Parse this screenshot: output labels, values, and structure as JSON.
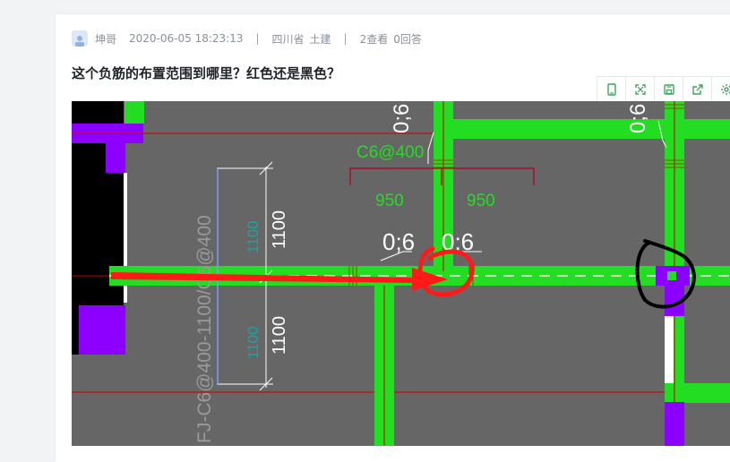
{
  "post": {
    "author": "坤哥",
    "datetime": "2020-06-05 18:23:13",
    "separator": "|",
    "province": "四川省",
    "category": "土建",
    "views": "2查看",
    "answers": "0回答",
    "title": "这个负筋的布置范围到哪里？红色还是黑色？"
  },
  "toolbar": {
    "buttons": [
      "tablet-icon",
      "fullscreen-icon",
      "save-icon",
      "share-icon",
      "settings-icon"
    ]
  },
  "drawing": {
    "spacing_label": "C6@400",
    "left_extent": "950",
    "right_extent": "950",
    "left_node": "0;6",
    "right_node": "0;6",
    "top_right_node": "0;6",
    "top_node": "0;6",
    "dim_upper": "1100",
    "dim_lower": "1100",
    "dim_upper_inner": "1100",
    "dim_lower_inner": "1100",
    "rebar_spec": "FJ-C6@400-1100/C6@400",
    "colors": {
      "background": "#666666",
      "beam": "#22dd22",
      "column": "#8b00ff",
      "red_line": "#cc0000",
      "arrow": "#ff1a1a",
      "ink": "#000000"
    }
  }
}
